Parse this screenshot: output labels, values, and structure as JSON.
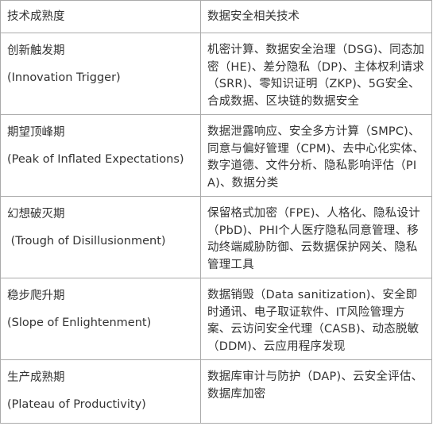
{
  "header": {
    "col1": "技术成熟度",
    "col2": "数据安全相关技术"
  },
  "rows": [
    {
      "stage_cn": "创新触发期",
      "stage_en": "(Innovation Trigger)",
      "tech": "机密计算、数据安全治理（DSG)、同态加密（HE)、差分隐私（DP)、主体权利请求（SRR)、零知识证明（ZKP)、5G安全、合成数据、区块链的数据安全"
    },
    {
      "stage_cn": "期望顶峰期",
      "stage_en": "(Peak of Inflated Expectations)",
      "tech": "数据泄露响应、安全多方计算（SMPC)、同意与偏好管理（CPM)、去中心化实体、数字道德、文件分析、隐私影响评估（PIA)、数据分类"
    },
    {
      "stage_cn": "幻想破灭期",
      "stage_en": " (Trough of Disillusionment)",
      "tech": "保留格式加密（FPE)、人格化、隐私设计（PbD)、PHI个人医疗隐私同意管理、移动终端威胁防御、云数据保护网关、隐私管理工具"
    },
    {
      "stage_cn": "稳步爬升期",
      "stage_en": "(Slope of Enlightenment)",
      "tech": "数据销毁（Data sanitization)、安全即时通讯、电子取证软件、IT风险管理方案、云访问安全代理（CASB)、动态脱敏（DDM)、云应用程序发现"
    },
    {
      "stage_cn": "生产成熟期",
      "stage_en": "(Plateau of Productivity)",
      "tech": "数据库审计与防护（DAP)、云安全评估、数据库加密"
    }
  ]
}
